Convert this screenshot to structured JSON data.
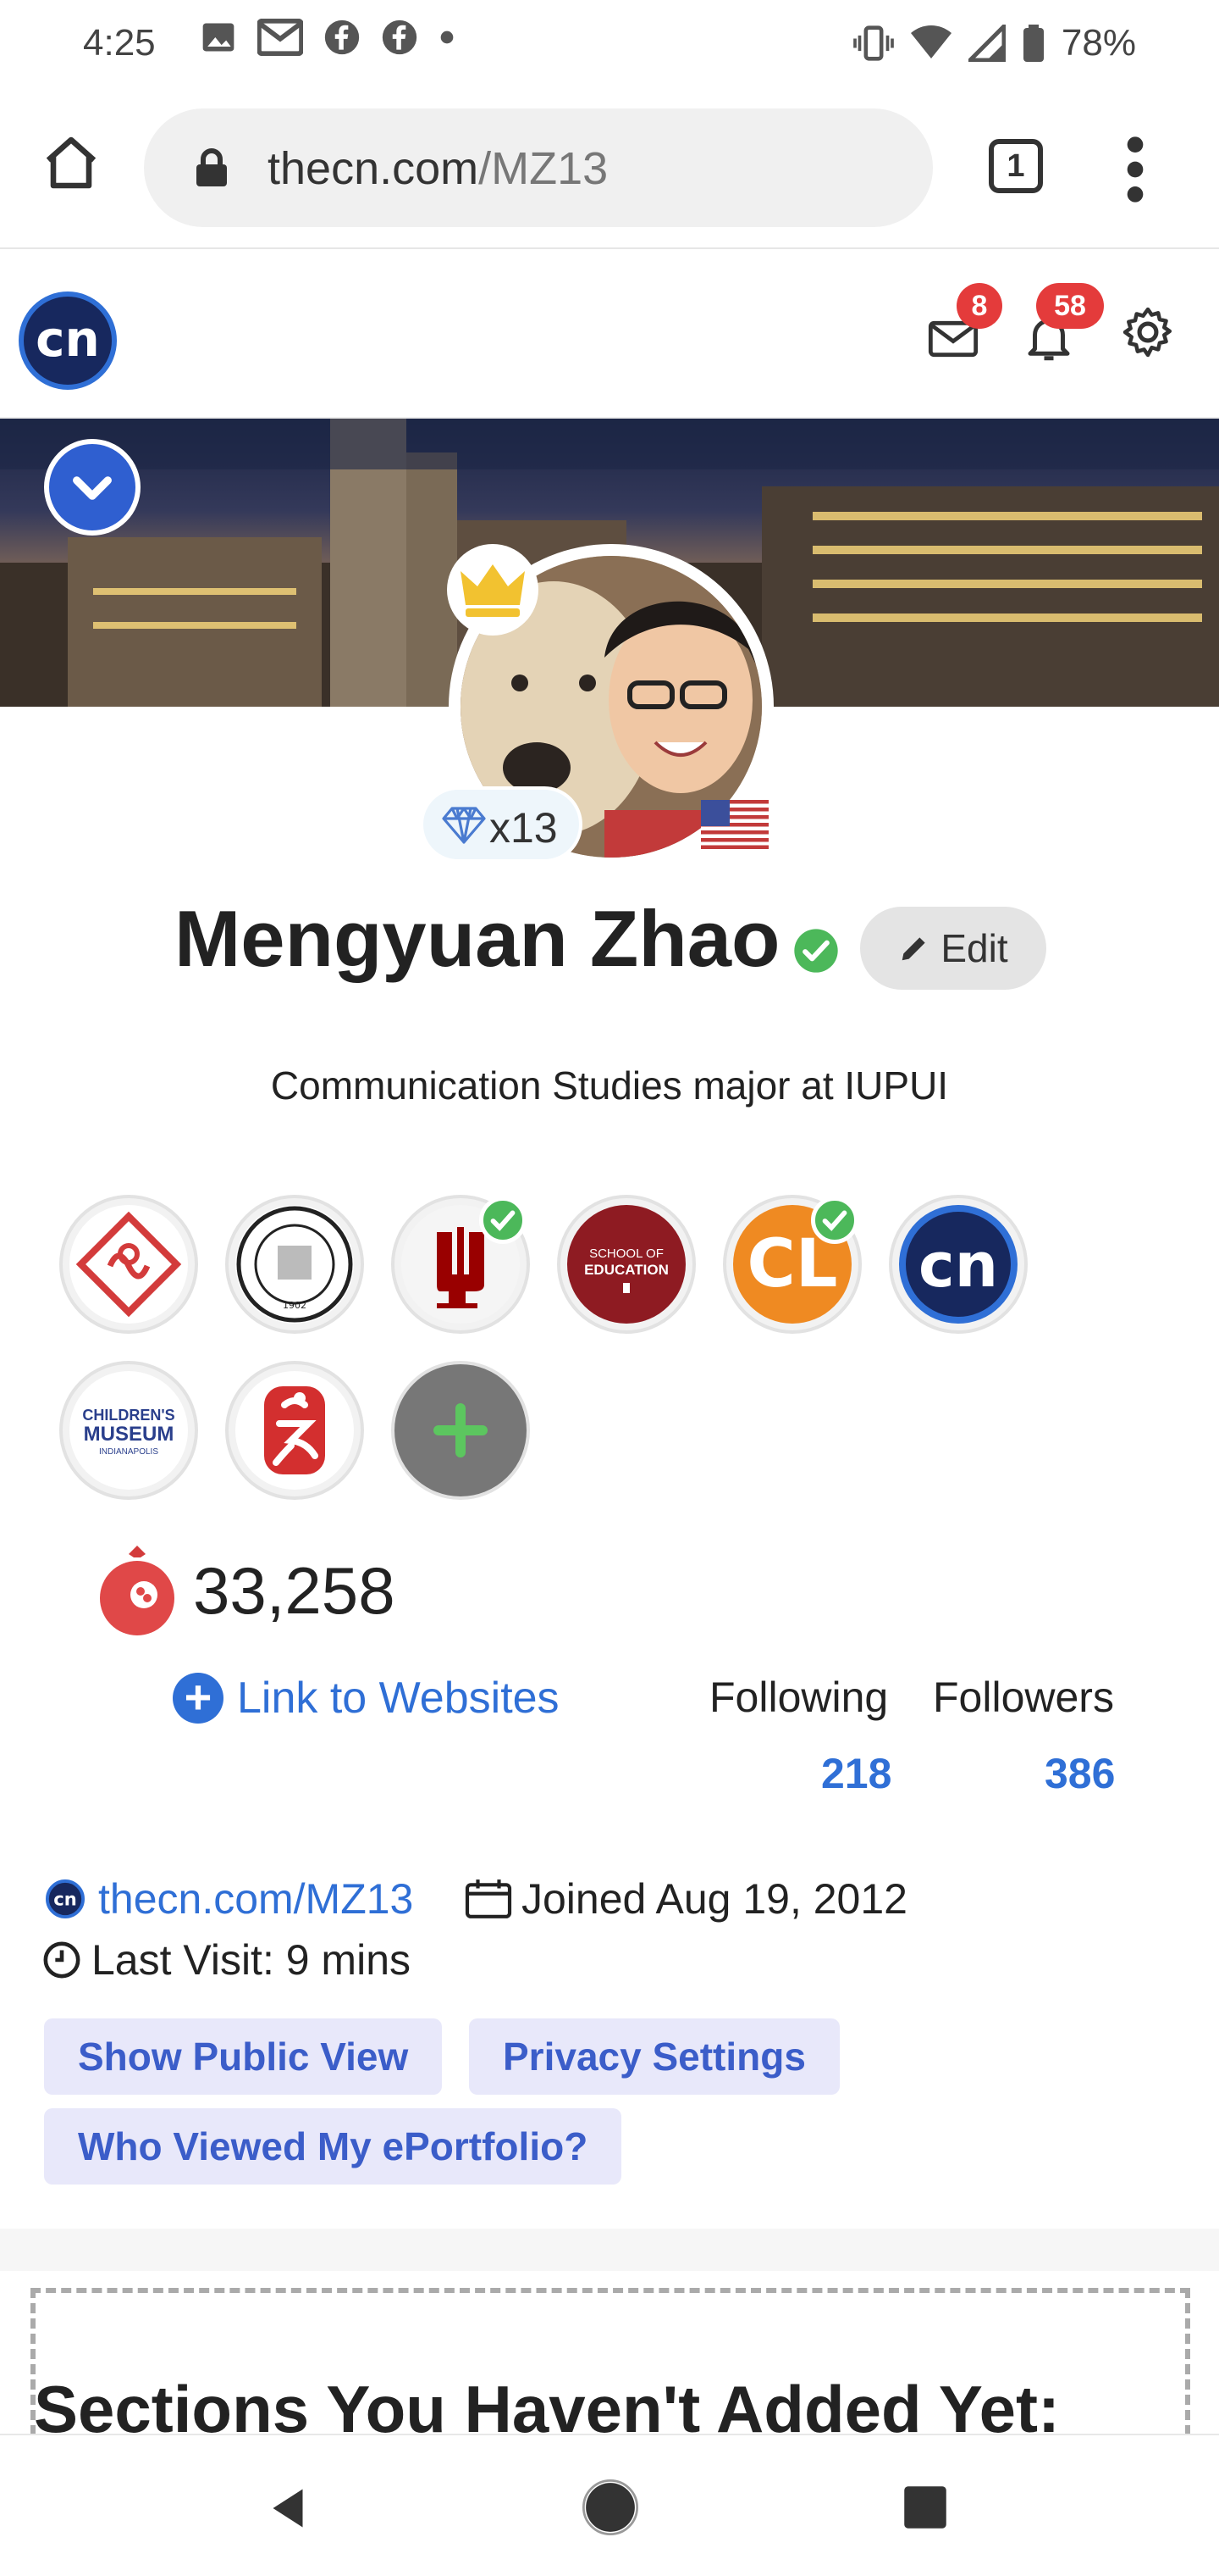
{
  "status_bar": {
    "time": "4:25",
    "battery": "78%",
    "icons": [
      "image-icon",
      "gmail-icon",
      "facebook-icon",
      "facebook-icon",
      "dot-icon",
      "vibrate-icon",
      "wifi-icon",
      "signal-icon",
      "battery-icon"
    ]
  },
  "browser": {
    "url_host": "thecn.com",
    "url_path": "/MZ13",
    "tab_count": "1"
  },
  "top_nav": {
    "logo": "cn",
    "mail_badge": "8",
    "notification_badge": "58"
  },
  "profile": {
    "name": "Mengyuan Zhao",
    "gem_count": "x13",
    "edit_label": "Edit",
    "tagline": "Communication Studies major at IUPUI",
    "points": "33,258",
    "link_websites": "Link to Websites",
    "following_label": "Following",
    "followers_label": "Followers",
    "following_count": "218",
    "followers_count": "386",
    "profile_url": "thecn.com/MZ13",
    "joined": "Joined Aug 19, 2012",
    "last_visit": "Last Visit: 9 mins"
  },
  "orgs": {
    "school_label": "SCHOOL OF",
    "education_label": "EDUCATION",
    "cl_label": "CL",
    "cn_label": "cn",
    "childrens_label": "CHILDREN'S",
    "museum_label": "MUSEUM",
    "indianapolis_label": "INDIANAPOLIS",
    "bnu_year": "1902"
  },
  "actions": {
    "public_view": "Show Public View",
    "privacy": "Privacy Settings",
    "who_viewed": "Who Viewed My ePortfolio?"
  },
  "sections": {
    "title": "Sections You Haven't Added Yet:"
  },
  "colors": {
    "accent": "#2f6fd6",
    "badge": "#e43b3b",
    "verified": "#4cb85a",
    "pill_bg": "#e8e8fa"
  }
}
